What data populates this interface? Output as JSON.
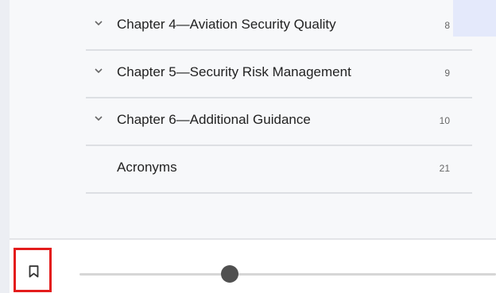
{
  "toc": {
    "items": [
      {
        "label": "Chapter 4—Aviation Security Quality",
        "page": "8",
        "expandable": true
      },
      {
        "label": "Chapter 5—Security Risk Management",
        "page": "9",
        "expandable": true
      },
      {
        "label": "Chapter 6—Additional Guidance",
        "page": "10",
        "expandable": true
      },
      {
        "label": "Acronyms",
        "page": "21",
        "expandable": false
      }
    ]
  },
  "toolbar": {
    "bookmark_icon": "bookmark-icon",
    "highlight_color": "#e31b1b",
    "slider_position_fraction": 0.36
  },
  "colors": {
    "panel_background": "#f7f8fa",
    "divider": "#dddfe3",
    "accent": "#e4e9fb",
    "slider_thumb": "#505050"
  }
}
